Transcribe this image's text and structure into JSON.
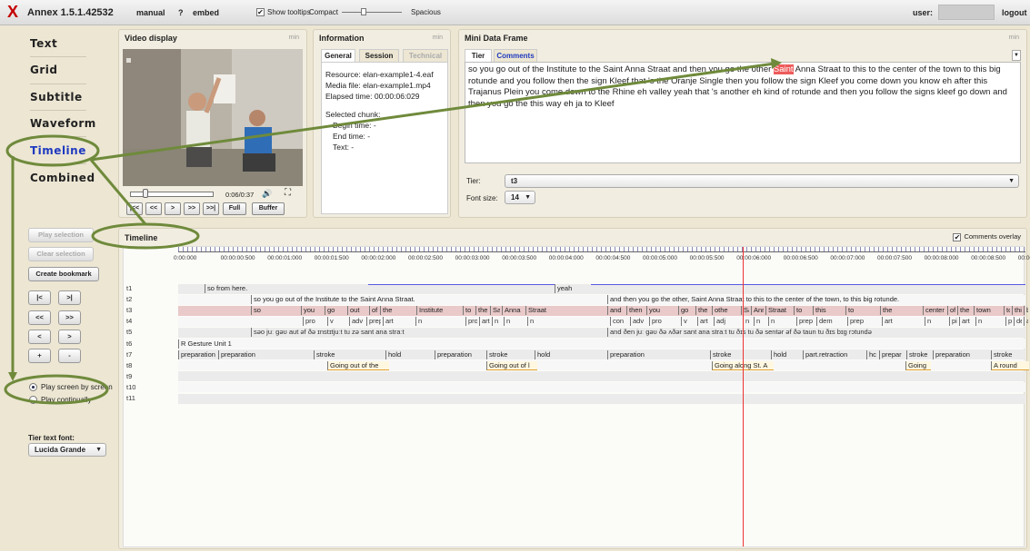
{
  "app": {
    "logo": "X",
    "title": "Annex 1.5.1.42532",
    "nav_manual": "manual",
    "nav_help": "?",
    "nav_embed": "embed",
    "show_tooltips": "Show tooltips",
    "compact": "Compact",
    "spacious": "Spacious",
    "user_label": "user:",
    "logout": "logout"
  },
  "leftnav": [
    "Text",
    "Grid",
    "Subtitle",
    "Waveform",
    "Timeline",
    "Combined"
  ],
  "controls": {
    "play_selection": "Play selection",
    "clear_selection": "Clear selection",
    "create_bookmark": "Create bookmark",
    "nav_buttons": [
      "|<",
      ">|",
      "<<",
      ">>",
      "<",
      ">",
      "+",
      "-"
    ],
    "play_screen": "Play screen by screen",
    "play_continually": "Play continually",
    "tier_font_label": "Tier text font:",
    "tier_font_value": "Lucida Grande"
  },
  "video": {
    "title": "Video display",
    "min": "min",
    "time": "0:06/0:37",
    "buttons": [
      "|<<",
      "<<",
      ">",
      ">>",
      ">>|",
      "Full",
      "Buffer"
    ]
  },
  "info": {
    "title": "Information",
    "min": "min",
    "tabs": [
      "General",
      "Session",
      "Technical"
    ],
    "resource": "Resource:  elan-example1-4.eaf",
    "media": "Media file:  elan-example1.mp4",
    "elapsed": "Elapsed time:     00:00:06:029",
    "selected": "Selected chunk:",
    "begin": "Begin time:      -",
    "end": "End time:        -",
    "text": "Text:     -"
  },
  "mdf": {
    "title": "Mini Data Frame",
    "min": "min",
    "tabs": [
      "Tier",
      "Comments"
    ],
    "text_before": "so you go out of the Institute to the Saint Anna Straat and then you go the other ",
    "text_highlight": "Saint",
    "text_after": " Anna Straat to this to the center of the town to this big rotunde and you follow then the sign Kleef that 's the Oranje Single then you follow the sign Kleef you come down you know eh after this Trajanus Plein you come down to the Rhine eh valley yeah that 's another eh kind of rotunde and then you follow the signs kleef go down and then you go the this way eh ja to Kleef",
    "tier_label": "Tier:",
    "tier_value": "t3",
    "font_label": "Font size:",
    "font_value": "14"
  },
  "timeline": {
    "title": "Timeline",
    "overlay": "Comments overlay",
    "ticks": [
      "0:00:000",
      "00:00:00:500",
      "00:00:01:000",
      "00:00:01:500",
      "00:00:02:000",
      "00:00:02:500",
      "00:00:03:000",
      "00:00:03:500",
      "00:00:04:000",
      "00:00:04:500",
      "00:00:05:000",
      "00:00:05:500",
      "00:00:06:000",
      "00:00:06:500",
      "00:00:07:000",
      "00:00:07:500",
      "00:00:08:000",
      "00:00:08:500",
      "00:00:0"
    ],
    "tiers": [
      "t1",
      "t2",
      "t3",
      "t4",
      "t5",
      "t6",
      "t7",
      "t8",
      "t9",
      "t10",
      "t11"
    ],
    "t1": [
      "so from here.",
      "yeah"
    ],
    "t2": [
      "so you go out of the Institute to the Saint Anna Straat.",
      "and then you go the other, Saint Anna Straat to this to the center of the town, to this big rotunde."
    ],
    "t3": [
      "so",
      "you",
      "go",
      "out",
      "of",
      "the",
      "Institute",
      "to",
      "the",
      "Sai",
      "Anna",
      "Straat",
      "and",
      "then",
      "you",
      "go",
      "the",
      "othe",
      "Saint",
      "Ann",
      "Straat",
      "to",
      "this",
      "to",
      "the",
      "center",
      "of",
      "the",
      "town",
      "to",
      "thi",
      "big"
    ],
    "t4": [
      "pro",
      "v",
      "adv",
      "prep",
      "art",
      "n",
      "pro",
      "art",
      "n",
      "n",
      "n",
      "con",
      "adv",
      "pro",
      "v",
      "art",
      "adj",
      "n",
      "n",
      "n",
      "prep",
      "dem",
      "prep",
      "art",
      "n",
      "pi",
      "art",
      "n",
      "pr",
      "de",
      "adj"
    ],
    "t5": [
      "səo juː gəʊ aut əf ðə ɪnstɪtjuːt tu zə sant ana straːt",
      "and ðen juː gəʊ ðə ʌðər sant ana straːt tu ðɪs tu ðə sentər əf ðə taun tu ðɪs bɪg rɔtundə"
    ],
    "t6": [
      "R Gesture Unit 1"
    ],
    "t7": [
      "preparation",
      "preparation",
      "stroke",
      "hold",
      "preparation",
      "stroke",
      "hold",
      "preparation",
      "stroke",
      "hold",
      "part.retraction",
      "hc",
      "prepar",
      "stroke",
      "preparation",
      "stroke"
    ],
    "t8": [
      "Going out of the",
      "Going out of l",
      "Going along St. A",
      "Going",
      "A round"
    ]
  }
}
